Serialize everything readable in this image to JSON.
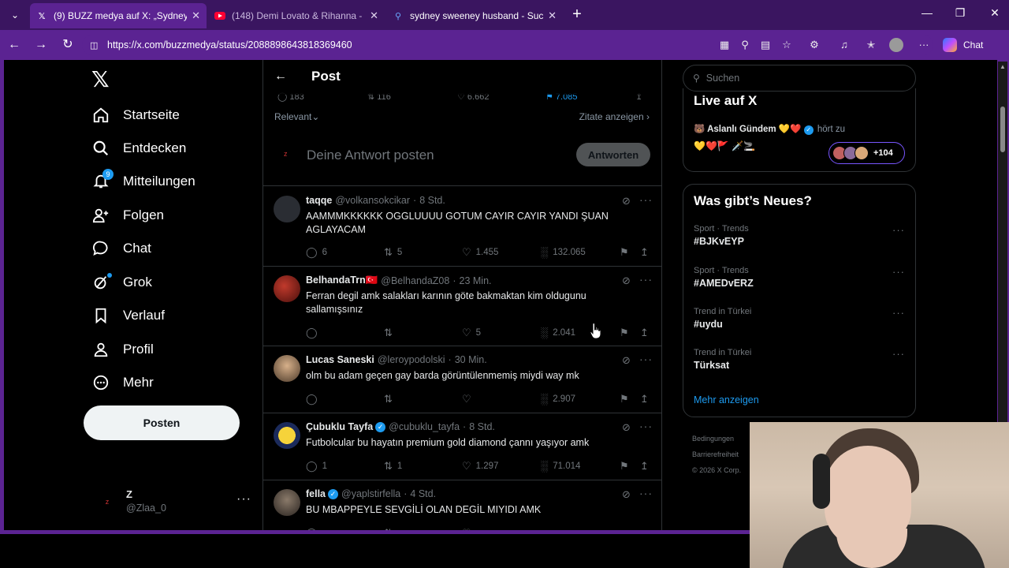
{
  "browser": {
    "tabs": [
      {
        "title": "(9) BUZZ medya auf X: „Sydney Sw",
        "favicon": "X",
        "active": true
      },
      {
        "title": "(148) Demi Lovato & Rihanna - Sta",
        "favicon": "youtube",
        "active": false
      },
      {
        "title": "sydney sweeney husband - Suche",
        "favicon": "search",
        "active": false
      }
    ],
    "url": "https://x.com/buzzmedya/status/2088898643818369460",
    "chat_label": "Chat",
    "accent": "#5b2392"
  },
  "nav": {
    "items": [
      {
        "label": "Startseite",
        "icon": "home-icon"
      },
      {
        "label": "Entdecken",
        "icon": "search-icon"
      },
      {
        "label": "Mitteilungen",
        "icon": "bell-icon",
        "badge": "9"
      },
      {
        "label": "Folgen",
        "icon": "follow-icon"
      },
      {
        "label": "Chat",
        "icon": "chat-icon"
      },
      {
        "label": "Grok",
        "icon": "grok-icon"
      },
      {
        "label": "Verlauf",
        "icon": "bookmark-icon"
      },
      {
        "label": "Profil",
        "icon": "profile-icon"
      },
      {
        "label": "Mehr",
        "icon": "more-icon"
      }
    ],
    "post_button": "Posten",
    "account": {
      "name": "Z",
      "handle": "@Zlaa_0",
      "avatar": "z"
    }
  },
  "post": {
    "header_title": "Post",
    "stats": {
      "replies": "183",
      "reposts": "116",
      "likes": "6.662",
      "bookmarks": "7.085"
    },
    "sort_label": "Relevant",
    "quotes_label": "Zitate anzeigen",
    "reply_placeholder": "Deine Antwort posten",
    "reply_button": "Antworten",
    "reply_avatar": "z"
  },
  "replies": [
    {
      "name": "taqqe",
      "verified": false,
      "handle": "@volkansokcikar",
      "time": "8 Std.",
      "text": "AAMMMKKKKKK OGGLUUUU GOTUM CAYIR CAYIR YANDI ŞUAN AGLAYACAM",
      "replies": "6",
      "reposts": "5",
      "likes": "1.455",
      "views": "132.065"
    },
    {
      "name": "BelhandaTrn🇹🇷",
      "verified": false,
      "handle": "@BelhandaZ08",
      "time": "23 Min.",
      "text": "Ferran degil amk salakları karının göte bakmaktan kim oldugunu sallamışsınız",
      "replies": "",
      "reposts": "",
      "likes": "5",
      "views": "2.041"
    },
    {
      "name": "Lucas Saneski",
      "verified": false,
      "handle": "@leroypodolski",
      "time": "30 Min.",
      "text": "olm bu adam geçen gay barda görüntülenmemiş miydi way mk",
      "replies": "",
      "reposts": "",
      "likes": "",
      "views": "2.907"
    },
    {
      "name": "Çubuklu Tayfa",
      "verified": true,
      "handle": "@cubuklu_tayfa",
      "time": "8 Std.",
      "text": "Futbolcular bu hayatın premium gold diamond çannı yaşıyor amk",
      "replies": "1",
      "reposts": "1",
      "likes": "1.297",
      "views": "71.014"
    },
    {
      "name": "fella",
      "verified": true,
      "handle": "@yaplstirfella",
      "time": "4 Std.",
      "text": "BU MBAPPEYLE SEVGİLİ OLAN DEGİL MIYIDI AMK",
      "replies": "",
      "reposts": "",
      "likes": "",
      "views": ""
    }
  ],
  "sidebar": {
    "search_placeholder": "Suchen",
    "live": {
      "title": "Live auf X",
      "host": "🐻 Aslanlı Gündem 💛❤️",
      "status": "hört zu",
      "emoji_line": "💛❤️🚩 🗡️🚬",
      "listener_count": "+104"
    },
    "trends_title": "Was gibt’s Neues?",
    "trends": [
      {
        "category": "Sport · Trends",
        "tag": "#BJKvEYP"
      },
      {
        "category": "Sport · Trends",
        "tag": "#AMEDvERZ"
      },
      {
        "category": "Trend in Türkei",
        "tag": "#uydu"
      },
      {
        "category": "Trend in Türkei",
        "tag": "Türksat"
      }
    ],
    "show_more": "Mehr anzeigen",
    "footer": [
      "Bedingungen",
      "Barrierefreiheit",
      "© 2026 X Corp."
    ]
  }
}
